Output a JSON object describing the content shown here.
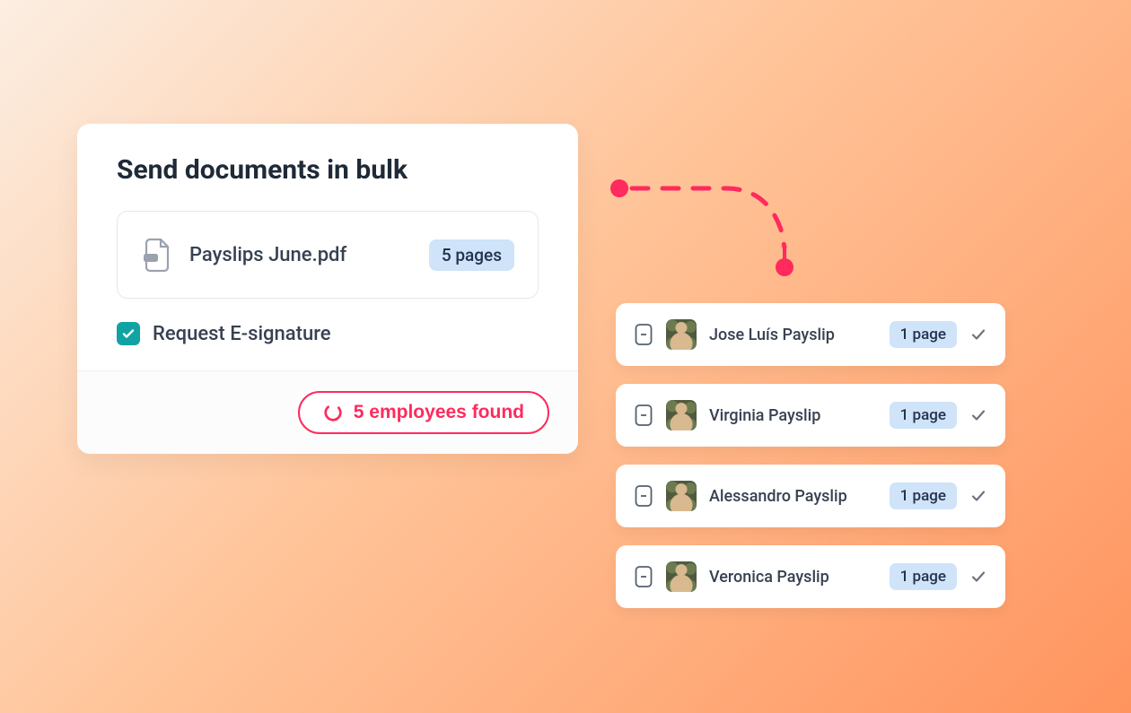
{
  "title": "Send documents in bulk",
  "file": {
    "name": "Payslips June.pdf",
    "pages_label": "5 pages"
  },
  "esignature_label": "Request E-signature",
  "esignature_checked": true,
  "footer_label": "5 employees found",
  "employees": [
    {
      "label": "Jose Luís Payslip",
      "pages_label": "1 page"
    },
    {
      "label": "Virginia Payslip",
      "pages_label": "1 page"
    },
    {
      "label": "Alessandro Payslip",
      "pages_label": "1 page"
    },
    {
      "label": "Veronica Payslip",
      "pages_label": "1 page"
    }
  ],
  "colors": {
    "accent": "#ff2a5e",
    "teal": "#10a3a3",
    "badge_bg": "#cfe3f9"
  }
}
